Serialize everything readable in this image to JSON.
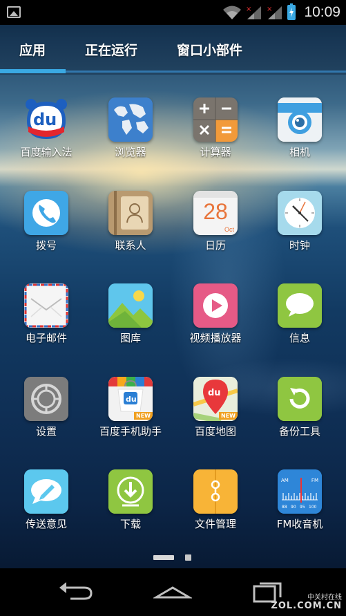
{
  "status_bar": {
    "time": "10:09",
    "icons": [
      "image-icon",
      "wifi-icon",
      "signal-icon-1",
      "signal-icon-2",
      "battery-charging-icon"
    ]
  },
  "tabs": [
    {
      "label": "应用",
      "selected": true
    },
    {
      "label": "正在运行",
      "selected": false
    },
    {
      "label": "窗口小部件",
      "selected": false
    }
  ],
  "apps": [
    {
      "label": "百度输入法",
      "icon": "baidu-input-icon"
    },
    {
      "label": "浏览器",
      "icon": "browser-globe-icon"
    },
    {
      "label": "计算器",
      "icon": "calculator-icon"
    },
    {
      "label": "相机",
      "icon": "camera-icon"
    },
    {
      "label": "拨号",
      "icon": "phone-icon"
    },
    {
      "label": "联系人",
      "icon": "contacts-icon"
    },
    {
      "label": "日历",
      "icon": "calendar-icon",
      "day": "28",
      "month": "Oct"
    },
    {
      "label": "时钟",
      "icon": "clock-icon"
    },
    {
      "label": "电子邮件",
      "icon": "email-icon"
    },
    {
      "label": "图库",
      "icon": "gallery-icon"
    },
    {
      "label": "视频播放器",
      "icon": "video-player-icon"
    },
    {
      "label": "信息",
      "icon": "messages-icon"
    },
    {
      "label": "设置",
      "icon": "settings-icon"
    },
    {
      "label": "百度手机助手",
      "icon": "baidu-assistant-icon",
      "badge": "NEW"
    },
    {
      "label": "百度地图",
      "icon": "baidu-map-icon",
      "badge": "NEW"
    },
    {
      "label": "备份工具",
      "icon": "backup-icon"
    },
    {
      "label": "传送意见",
      "icon": "feedback-icon"
    },
    {
      "label": "下载",
      "icon": "download-icon"
    },
    {
      "label": "文件管理",
      "icon": "file-manager-icon"
    },
    {
      "label": "FM收音机",
      "icon": "fm-radio-icon",
      "dial_labels": [
        "AM",
        "FM",
        "88",
        "90",
        "95",
        "100"
      ]
    }
  ],
  "page_indicator": {
    "pages": 2,
    "current": 1
  },
  "watermark": {
    "line1": "中关村在线",
    "line2": "ZOL.COM.CN"
  },
  "colors": {
    "accent": "#3aa9e3"
  }
}
